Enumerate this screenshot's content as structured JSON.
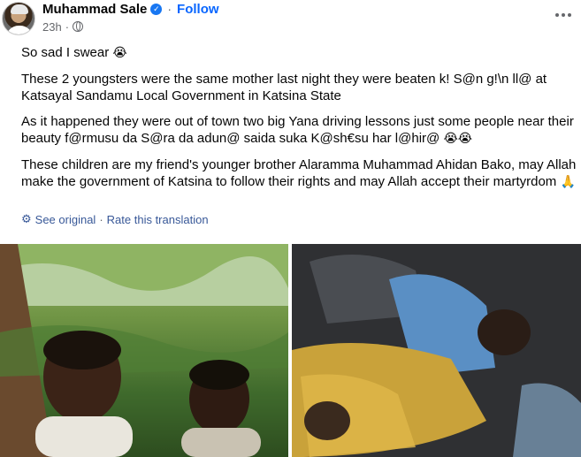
{
  "post": {
    "author": "Muhammad Sale",
    "separator": "·",
    "follow_label": "Follow",
    "timestamp": "23h",
    "visibility_separator": "·",
    "paragraphs": {
      "p1": "So sad I swear",
      "p1_emoji": "😭",
      "p2": "These 2 youngsters were the same mother last night they were beaten k! S@n g!\\n ll@ at Katsayal Sandamu Local Government in Katsina State",
      "p3": "As it happened they were out of town two big Yana driving lessons just some people near their beauty f@rmusu da S@ra da adun@ saida suka K@sh€su har l@hir@",
      "p3_emoji": "😭😭",
      "p4": "These children are my friend's younger brother Alaramma Muhammad Ahidan Bako, may Allah make the government of Katsina to follow their rights and may Allah accept their martyrdom",
      "p4_emoji": "🙏"
    },
    "translation": {
      "see_original": "See original",
      "separator": "·",
      "rate": "Rate this translation"
    }
  },
  "icons": {
    "verified": "verified-badge-icon",
    "globe": "globe-icon",
    "more": "more-options-icon",
    "gear": "gear-icon"
  },
  "colors": {
    "link": "#0866ff",
    "translation_link": "#385898",
    "secondary_text": "#65676b",
    "verified_badge": "#1877f2"
  }
}
